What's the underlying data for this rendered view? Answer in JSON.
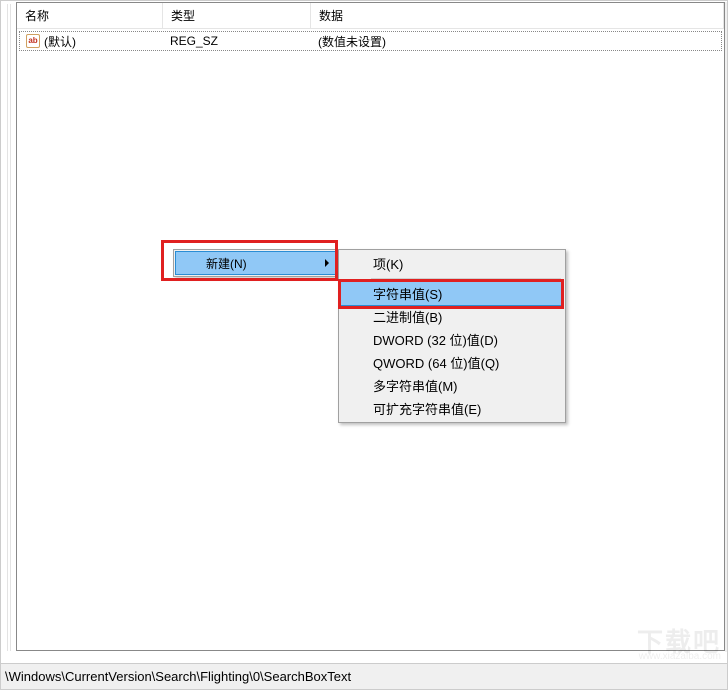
{
  "columns": {
    "name": "名称",
    "type": "类型",
    "data": "数据"
  },
  "rows": [
    {
      "icon": "ab",
      "name": "(默认)",
      "type": "REG_SZ",
      "data": "(数值未设置)"
    }
  ],
  "context_menu_1": {
    "items": [
      {
        "label": "新建(N)",
        "has_submenu": true,
        "hover": true
      }
    ]
  },
  "context_menu_2": {
    "items": [
      {
        "label": "项(K)",
        "hover": false
      },
      {
        "sep": true
      },
      {
        "label": "字符串值(S)",
        "hover": true
      },
      {
        "label": "二进制值(B)",
        "hover": false
      },
      {
        "label": "DWORD (32 位)值(D)",
        "hover": false
      },
      {
        "label": "QWORD (64 位)值(Q)",
        "hover": false
      },
      {
        "label": "多字符串值(M)",
        "hover": false
      },
      {
        "label": "可扩充字符串值(E)",
        "hover": false
      }
    ]
  },
  "status_path": "\\Windows\\CurrentVersion\\Search\\Flighting\\0\\SearchBoxText",
  "watermark": "下载吧",
  "watermark_url": "www.xiazaiba.com"
}
